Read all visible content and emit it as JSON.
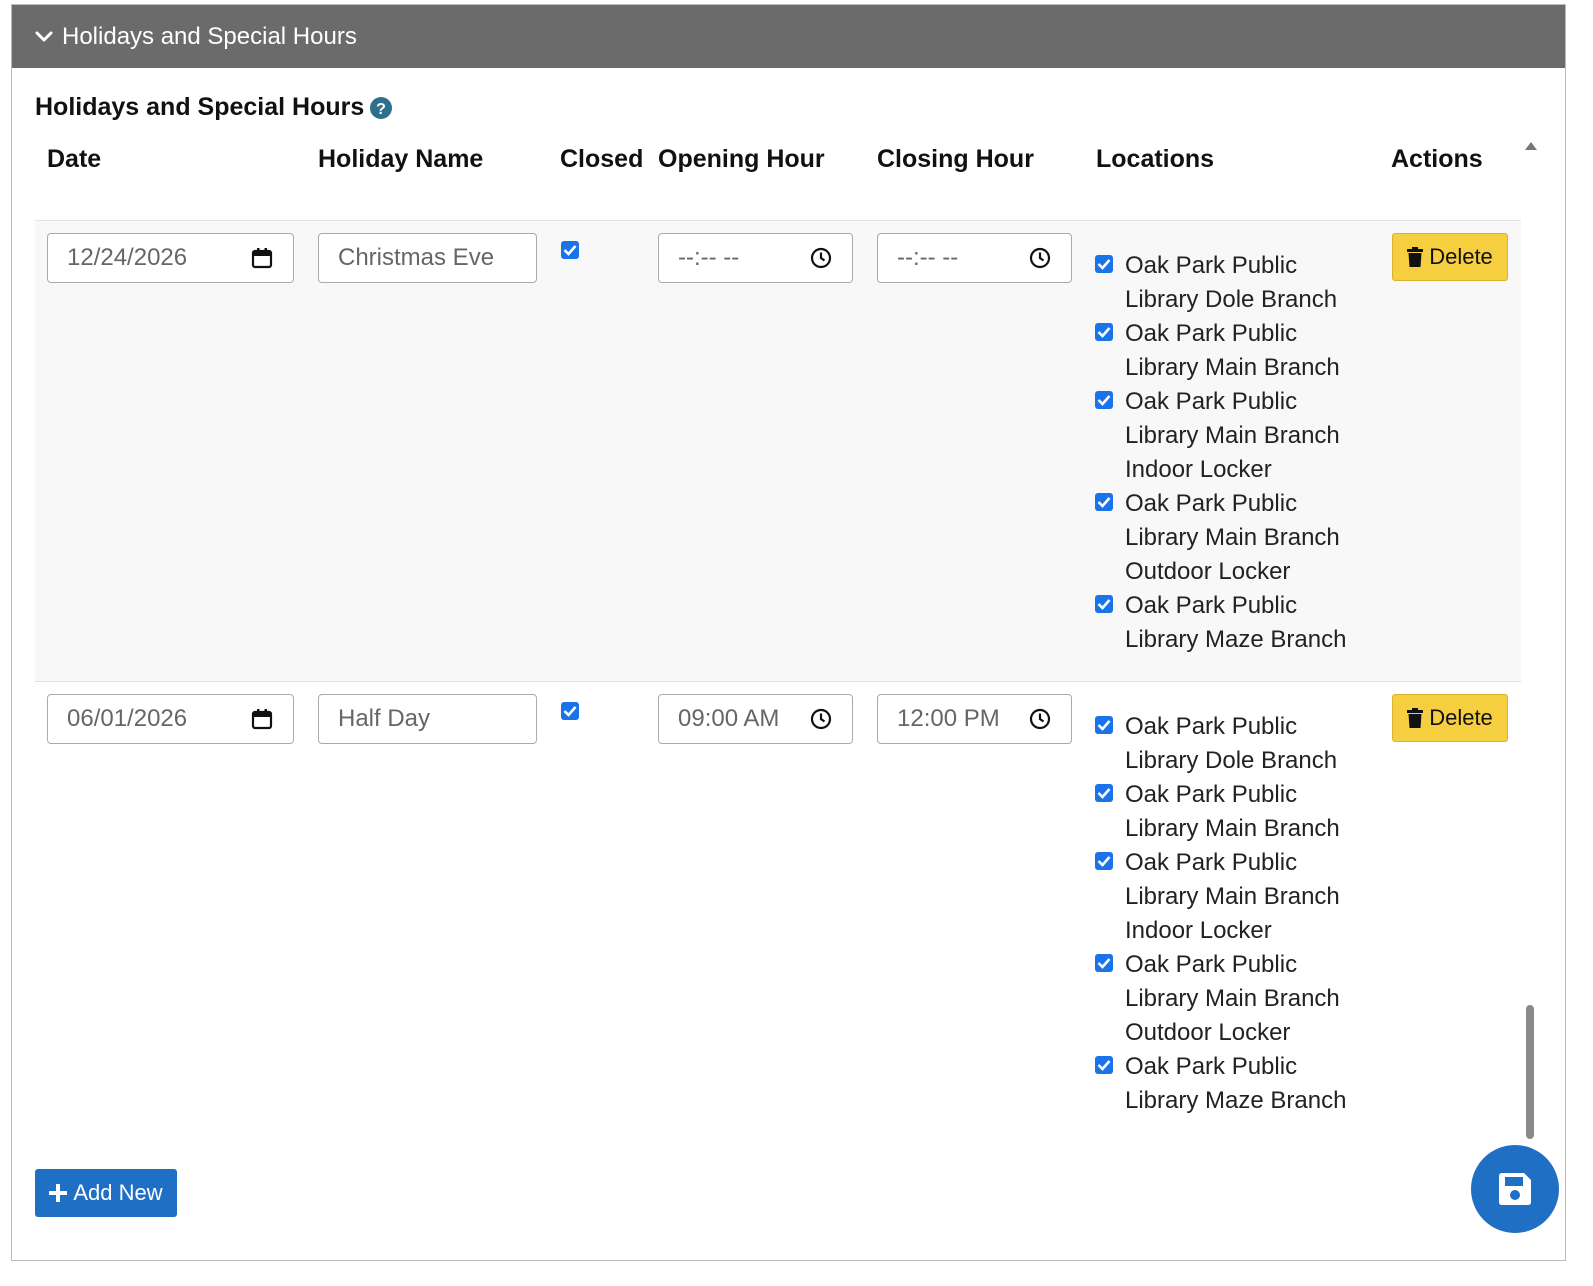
{
  "panel": {
    "title": "Holidays and Special Hours"
  },
  "section": {
    "title": "Holidays and Special Hours"
  },
  "table": {
    "headers": {
      "date": "Date",
      "holiday_name": "Holiday Name",
      "closed": "Closed",
      "opening_hour": "Opening Hour",
      "closing_hour": "Closing Hour",
      "locations": "Locations",
      "actions": "Actions"
    },
    "rows": [
      {
        "date": "12/24/2026",
        "holiday_name": "Christmas Eve",
        "closed": true,
        "opening_hour": "--:-- --",
        "closing_hour": "--:-- --",
        "locations": [
          "Oak Park Public Library Dole Branch",
          "Oak Park Public Library Main Branch",
          "Oak Park Public Library Main Branch Indoor Locker",
          "Oak Park Public Library Main Branch Outdoor Locker",
          "Oak Park Public Library Maze Branch"
        ],
        "delete_label": "Delete"
      },
      {
        "date": "06/01/2026",
        "holiday_name": "Half Day",
        "closed": true,
        "opening_hour": "09:00 AM",
        "closing_hour": "12:00 PM",
        "locations": [
          "Oak Park Public Library Dole Branch",
          "Oak Park Public Library Main Branch",
          "Oak Park Public Library Main Branch Indoor Locker",
          "Oak Park Public Library Main Branch Outdoor Locker",
          "Oak Park Public Library Maze Branch"
        ],
        "delete_label": "Delete"
      }
    ]
  },
  "footer": {
    "add_new_label": "Add New"
  },
  "colors": {
    "header_bg": "#6b6b6b",
    "checkbox": "#1a73e8",
    "delete_bg": "#f5cf3f",
    "primary": "#1f6fc4",
    "help_icon": "#2e6f8e"
  },
  "icons": {
    "header": "chevron-down-icon",
    "help": "question-circle-icon",
    "date": "calendar-icon",
    "time": "clock-icon",
    "delete": "trash-icon",
    "add": "plus-icon",
    "save": "floppy-disk-icon"
  }
}
